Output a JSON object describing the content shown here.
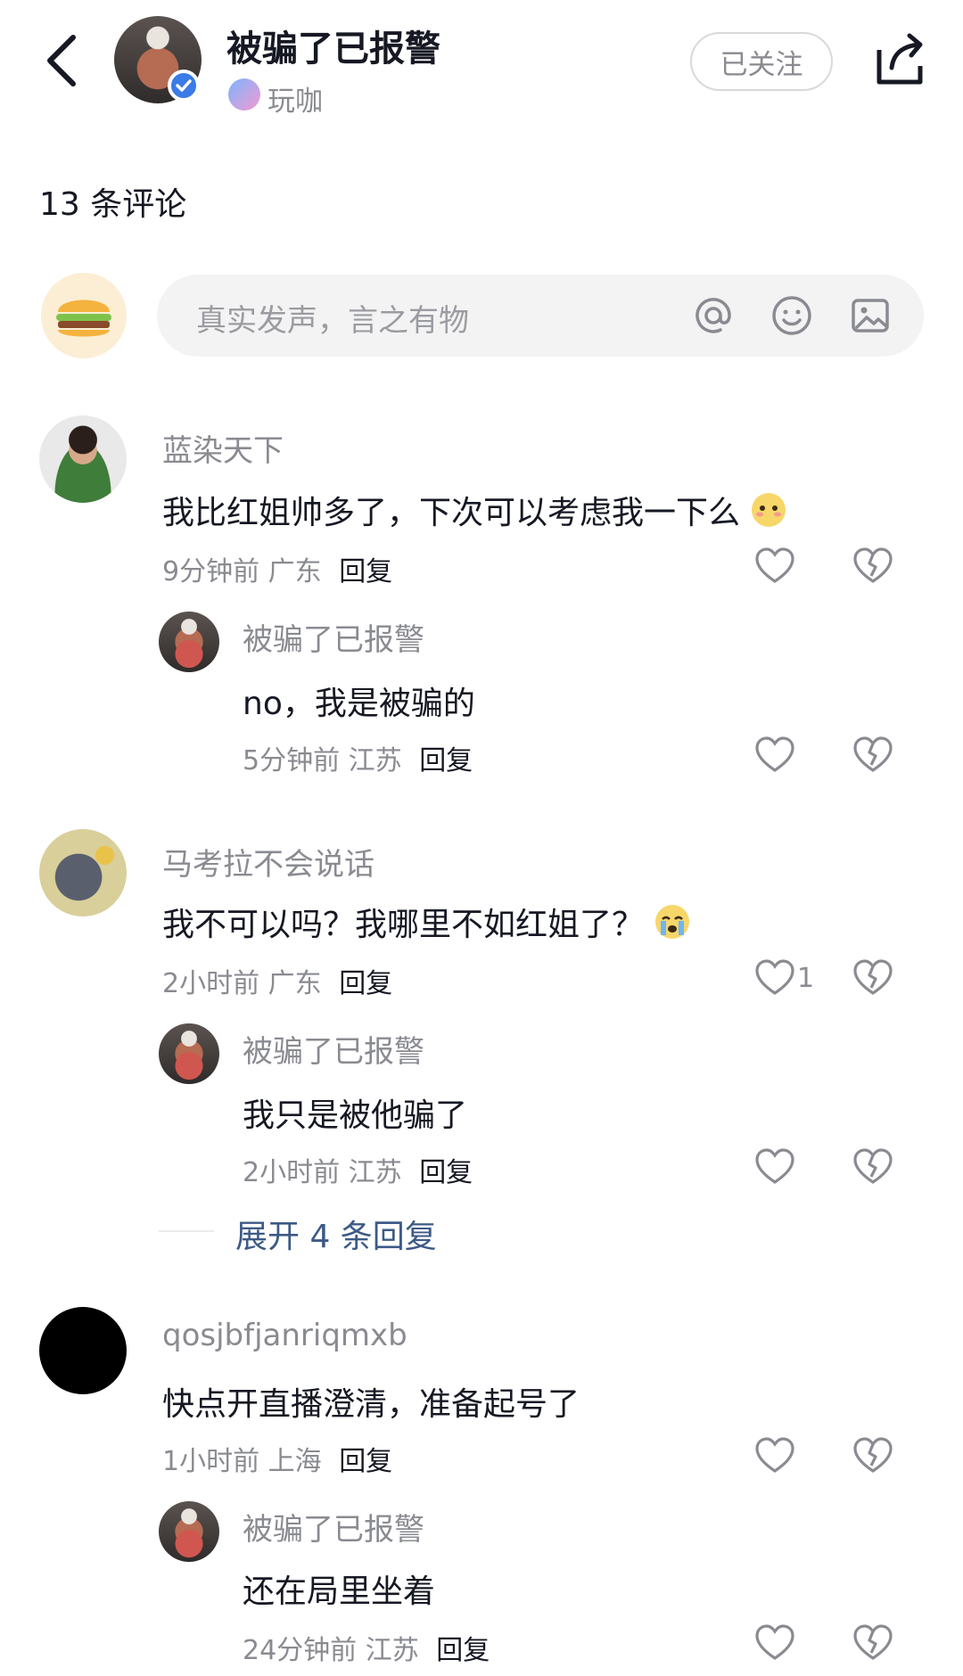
{
  "header": {
    "title": "被骗了已报警",
    "subtitle": "玩咖",
    "follow_label": "已关注"
  },
  "comments_count_label": "13 条评论",
  "input": {
    "placeholder": "真实发声，言之有物"
  },
  "comments": [
    {
      "name": "蓝染天下",
      "text": "我比红姐帅多了，下次可以考虑我一下么",
      "time": "9分钟前",
      "location": "广东",
      "reply_label": "回复",
      "likes": "",
      "reply": {
        "name": "被骗了已报警",
        "text": "no，我是被骗的",
        "time": "5分钟前",
        "location": "江苏",
        "reply_label": "回复"
      }
    },
    {
      "name": "马考拉不会说话",
      "text": "我不可以吗？我哪里不如红姐了？",
      "time": "2小时前",
      "location": "广东",
      "reply_label": "回复",
      "likes": "1",
      "reply": {
        "name": "被骗了已报警",
        "text": "我只是被他骗了",
        "time": "2小时前",
        "location": "江苏",
        "reply_label": "回复"
      },
      "expand_label": "展开 4 条回复"
    },
    {
      "name": "qosjbfjanriqmxb",
      "text": "快点开直播澄清，准备起号了",
      "time": "1小时前",
      "location": "上海",
      "reply_label": "回复",
      "likes": "",
      "reply": {
        "name": "被骗了已报警",
        "text": "还在局里坐着",
        "time": "24分钟前",
        "location": "江苏",
        "reply_label": "回复"
      }
    }
  ],
  "icons": {
    "back": "chevron-left-icon",
    "share": "share-icon",
    "at": "at-icon",
    "emoji": "emoji-icon",
    "image": "image-icon",
    "like": "heart-icon",
    "dislike": "broken-heart-icon"
  }
}
